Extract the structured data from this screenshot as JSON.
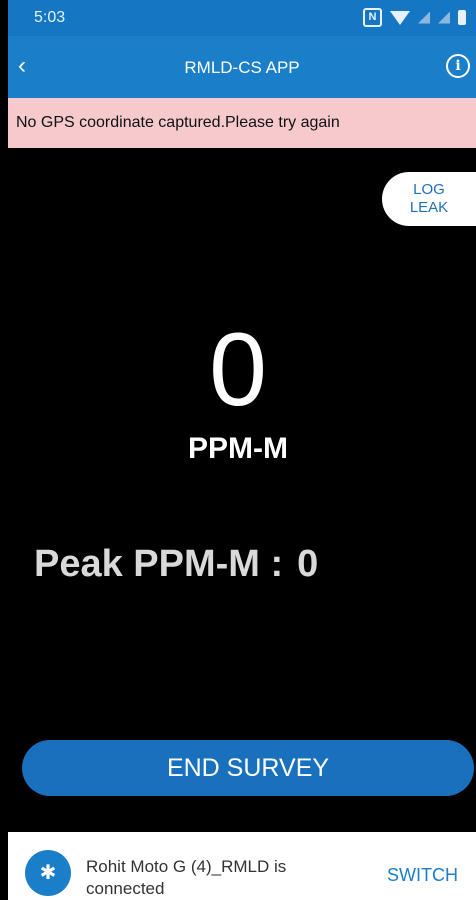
{
  "status_bar": {
    "time": "5:03",
    "icons": [
      "nfc-icon",
      "wifi-icon",
      "signal-icon",
      "battery-icon"
    ],
    "nfc_glyph": "N"
  },
  "app_bar": {
    "title": "RMLD-CS APP",
    "back_glyph": "‹",
    "info_glyph": "i",
    "color": "#1b7ec9"
  },
  "alert": {
    "message": "No GPS coordinate captured.Please try again",
    "color": "#f6c9cc"
  },
  "log_leak": {
    "line1": "LOG",
    "line2": "LEAK"
  },
  "reading": {
    "value": "0",
    "unit": "PPM-M"
  },
  "peak": {
    "label": "Peak PPM-M :",
    "value": "0"
  },
  "end_survey": {
    "label": "END SURVEY"
  },
  "bluetooth": {
    "device": "Rohit Moto G (4)_RMLD is connected",
    "icon_glyph": "✱",
    "switch_label": "SWITCH"
  }
}
